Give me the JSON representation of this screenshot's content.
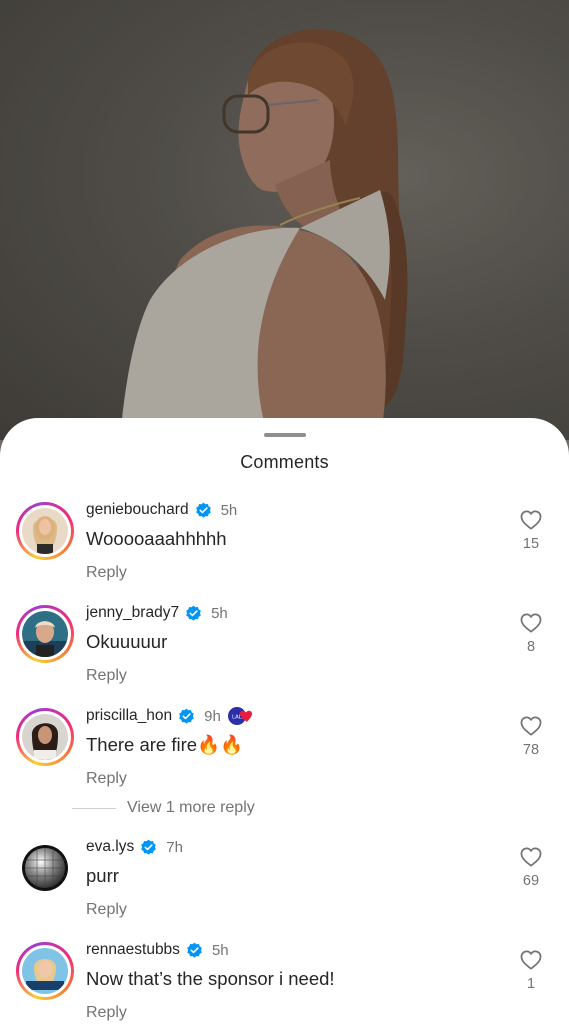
{
  "sheet": {
    "title": "Comments"
  },
  "view_more": "View 1 more reply",
  "reply_label": "Reply",
  "colors": {
    "verified": "#0095f6",
    "secondary_text": "#737373",
    "primary_text": "#262626"
  },
  "comments": [
    {
      "username": "geniebouchard",
      "verified": true,
      "time": "5h",
      "text": "Wooooaaahhhhh",
      "likes": "15",
      "avatar_icon": "profile-photo"
    },
    {
      "username": "jenny_brady7",
      "verified": true,
      "time": "5h",
      "text": "Okuuuuur",
      "likes": "8",
      "avatar_icon": "profile-photo"
    },
    {
      "username": "priscilla_hon",
      "verified": true,
      "time": "9h",
      "text": "There are fire🔥🔥",
      "likes": "78",
      "avatar_icon": "profile-photo",
      "badge": "LAL"
    },
    {
      "username": "eva.lys",
      "verified": true,
      "time": "7h",
      "text": "purr",
      "likes": "69",
      "avatar_icon": "disco-ball-photo"
    },
    {
      "username": "rennaestubbs",
      "verified": true,
      "time": "5h",
      "text": "Now that’s the sponsor i need!",
      "likes": "1",
      "avatar_icon": "profile-photo"
    }
  ]
}
